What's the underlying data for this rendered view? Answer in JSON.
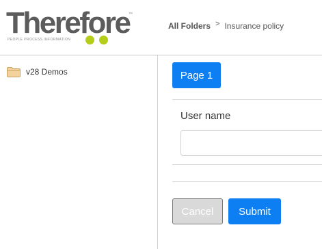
{
  "header": {
    "logo": {
      "wordmark": "Therefore",
      "trademark": "™",
      "tagline": "PEOPLE  PROCESS  INFORMATION",
      "dot_color": "#b5cc18"
    },
    "breadcrumb": {
      "root": "All Folders",
      "separator": ">",
      "current": "Insurance policy"
    }
  },
  "sidebar": {
    "items": [
      {
        "label": "v28 Demos",
        "icon": "folder-icon"
      }
    ]
  },
  "main": {
    "tabs": [
      {
        "label": "Page 1"
      }
    ],
    "form": {
      "fields": [
        {
          "label": "User name",
          "value": "",
          "placeholder": ""
        }
      ]
    },
    "buttons": {
      "cancel_label": "Cancel",
      "submit_label": "Submit"
    }
  },
  "colors": {
    "accent": "#0d7ff2",
    "disabled_button": "#d9d9d9",
    "brand_green": "#b5cc18",
    "brand_gray": "#5c5c5c",
    "folder": "#f0c98e"
  }
}
